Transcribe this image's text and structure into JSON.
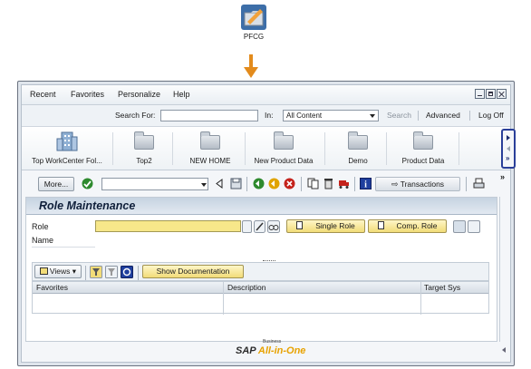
{
  "launcher": {
    "label": "PFCG",
    "icon": "pfcg-folder-icon",
    "arrow_color": "#e38b1c"
  },
  "menu": {
    "items": [
      "Recent",
      "Favorites",
      "Personalize",
      "Help"
    ]
  },
  "search": {
    "search_for_label": "Search For:",
    "search_for_value": "",
    "in_label": "In:",
    "in_value": "All Content",
    "search_btn": "Search",
    "advanced": "Advanced",
    "logoff": "Log Off"
  },
  "workcenters": [
    "Top WorkCenter Fol...",
    "Top2",
    "NEW HOME",
    "New Product Data",
    "Demo",
    "Product Data"
  ],
  "toolbar": {
    "more": "More...",
    "command_value": "",
    "transactions": "Transactions"
  },
  "page": {
    "title": "Role Maintenance",
    "role_label": "Role",
    "role_value": "",
    "name_label": "Name",
    "single_role": "Single Role",
    "comp_role": "Comp. Role"
  },
  "grid": {
    "views": "Views",
    "show_doc": "Show Documentation",
    "columns": [
      "Favorites",
      "Description",
      "Target Sys"
    ]
  },
  "footer": {
    "brand": "SAP",
    "business": "Business",
    "product": "All-in-One"
  },
  "colors": {
    "accent": "#e38b1c",
    "nav_border": "#2a3f99",
    "title_bg": "#c6d3e1",
    "input_yellow": "#f7e78a"
  }
}
